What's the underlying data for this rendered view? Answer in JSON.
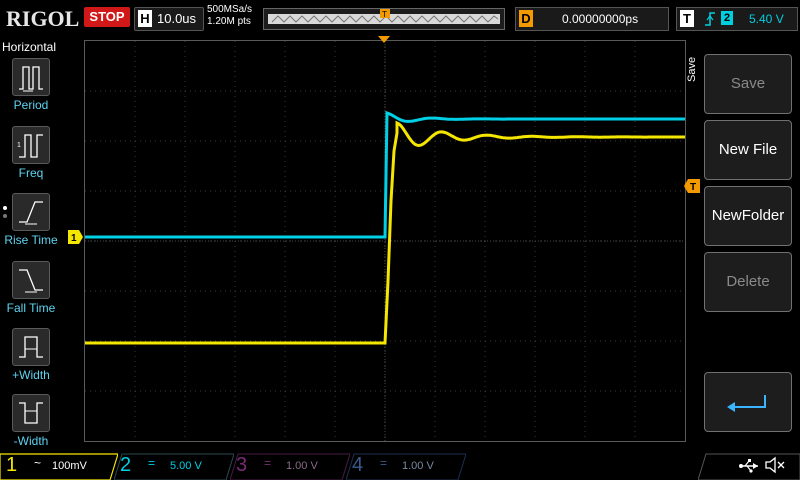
{
  "top": {
    "logo": "RIGOL",
    "run_state": "STOP",
    "horizontal": {
      "label": "H",
      "value": "10.0us"
    },
    "sample_rate": "500MSa/s",
    "memory_depth": "1.20M pts",
    "timeline_marker": "T",
    "delay": {
      "label": "D",
      "value": "0.00000000ps"
    },
    "trigger": {
      "label": "T",
      "source": "2",
      "level": "5.40 V"
    }
  },
  "left_panel": {
    "title": "Horizontal",
    "items": [
      {
        "label": "Period",
        "icon": "period-icon"
      },
      {
        "label": "Freq",
        "icon": "freq-icon"
      },
      {
        "label": "Rise Time",
        "icon": "rise-time-icon"
      },
      {
        "label": "Fall Time",
        "icon": "fall-time-icon"
      },
      {
        "label": "+Width",
        "icon": "plus-width-icon"
      },
      {
        "label": "-Width",
        "icon": "minus-width-icon"
      }
    ]
  },
  "right_panel": {
    "title": "Save",
    "buttons": [
      {
        "label": "Save",
        "enabled": false
      },
      {
        "label": "New File",
        "enabled": true
      },
      {
        "label": "NewFolder",
        "enabled": true
      },
      {
        "label": "Delete",
        "enabled": false
      }
    ],
    "back_icon": "return-arrow-icon"
  },
  "markers": {
    "ch1": "1",
    "trigger_level": "T"
  },
  "channels": [
    {
      "num": "1",
      "coupling": "~",
      "scale": "100mV",
      "color": "#f5e600"
    },
    {
      "num": "2",
      "coupling": "=",
      "scale": "5.00 V",
      "color": "#00d0e6"
    },
    {
      "num": "3",
      "coupling": "=",
      "scale": "1.00 V",
      "color": "#d000c8"
    },
    {
      "num": "4",
      "coupling": "=",
      "scale": "1.00 V",
      "color": "#2f6fe0"
    }
  ],
  "status_icons": [
    "usb-icon",
    "speaker-muted-icon"
  ],
  "colors": {
    "ch1": "#f5e600",
    "ch2": "#00d0e6",
    "trigger": "#f39a00",
    "stop": "#d01818",
    "menu_text": "#5fd3ef"
  }
}
